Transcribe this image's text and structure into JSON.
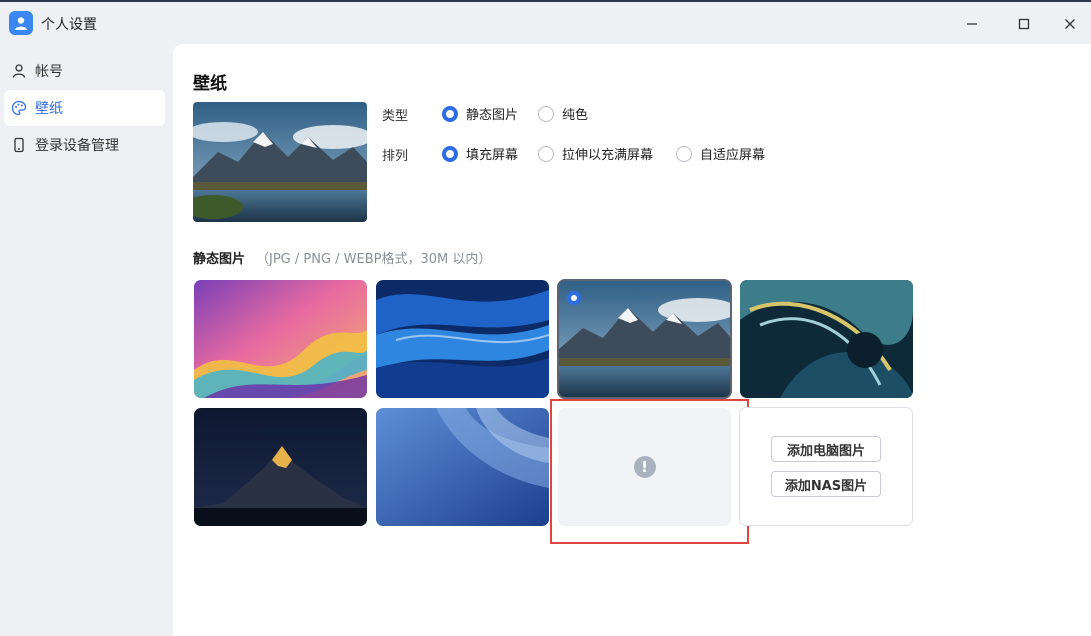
{
  "window": {
    "title": "个人设置",
    "controls": {
      "minimize": "—",
      "maximize": "☐",
      "close": "✕"
    }
  },
  "sidebar": {
    "items": [
      {
        "label": "帐号",
        "icon": "user-icon",
        "active": false
      },
      {
        "label": "壁纸",
        "icon": "palette-icon",
        "active": true
      },
      {
        "label": "登录设备管理",
        "icon": "phone-icon",
        "active": false
      }
    ]
  },
  "main": {
    "title": "壁纸",
    "options": {
      "type_label": "类型",
      "type_choices": [
        {
          "label": "静态图片",
          "selected": true
        },
        {
          "label": "纯色",
          "selected": false
        }
      ],
      "arrange_label": "排列",
      "arrange_choices": [
        {
          "label": "填充屏幕",
          "selected": true
        },
        {
          "label": "拉伸以充满屏幕",
          "selected": false
        },
        {
          "label": "自适应屏幕",
          "selected": false
        }
      ]
    },
    "section": {
      "title": "静态图片",
      "note": "（JPG / PNG / WEBP格式，30M 以内）"
    },
    "wallpapers": [
      {
        "name": "rainbow-wave",
        "selected": false
      },
      {
        "name": "blue-waves",
        "selected": false
      },
      {
        "name": "mountain-lake",
        "selected": true
      },
      {
        "name": "teal-swirl",
        "selected": false
      },
      {
        "name": "night-peak",
        "selected": false
      },
      {
        "name": "blue-gradient",
        "selected": false
      },
      {
        "name": "failed-image",
        "selected": false,
        "error_icon": "!"
      }
    ],
    "add": {
      "computer_label": "添加电脑图片",
      "nas_label": "添加NAS图片"
    }
  },
  "colors": {
    "accent": "#2e6ee5",
    "highlight": "#e0443e"
  }
}
